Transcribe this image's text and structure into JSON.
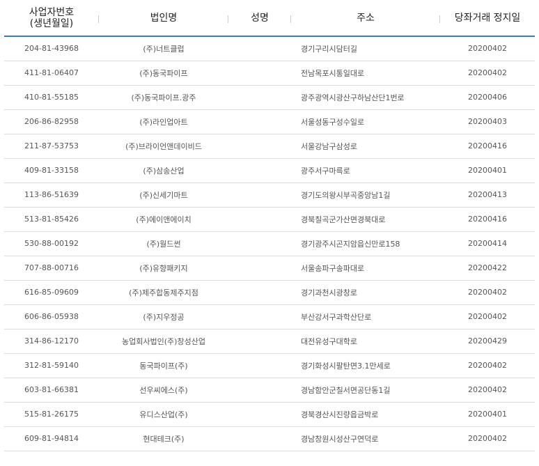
{
  "headers": {
    "biz_no_line1": "사업자번호",
    "biz_no_line2": "(생년월일)",
    "corp_name": "법인명",
    "person_name": "성명",
    "address": "주소",
    "suspend_date": "당좌거래 정지일"
  },
  "rows": [
    {
      "biz_no": "204-81-43968",
      "corp": "(주)너트클럽",
      "name": "",
      "addr": "경기구리시담터길",
      "date": "20200402"
    },
    {
      "biz_no": "411-81-06407",
      "corp": "(주)동국파이프",
      "name": "",
      "addr": "전남목포시통일대로",
      "date": "20200402"
    },
    {
      "biz_no": "410-81-55185",
      "corp": "(주)동국파이프.광주",
      "name": "",
      "addr": "광주광역시광산구하남산단1번로",
      "date": "20200406"
    },
    {
      "biz_no": "206-86-82958",
      "corp": "(주)라인업아트",
      "name": "",
      "addr": "서울성동구성수일로",
      "date": "20200403"
    },
    {
      "biz_no": "211-87-53753",
      "corp": "(주)브라이언앤데이비드",
      "name": "",
      "addr": "서울강남구삼성로",
      "date": "20200416"
    },
    {
      "biz_no": "409-81-33158",
      "corp": "(주)삼송산업",
      "name": "",
      "addr": "광주서구마륵로",
      "date": "20200401"
    },
    {
      "biz_no": "113-86-51639",
      "corp": "(주)신세기마트",
      "name": "",
      "addr": "경기도의왕시부곡중앙남1길",
      "date": "20200413"
    },
    {
      "biz_no": "513-81-85426",
      "corp": "(주)에이앤에이치",
      "name": "",
      "addr": "경북칠곡군가산면경북대로",
      "date": "20200416"
    },
    {
      "biz_no": "530-88-00192",
      "corp": "(주)월드썬",
      "name": "",
      "addr": "경기광주시곤지암읍신만로158",
      "date": "20200414"
    },
    {
      "biz_no": "707-88-00716",
      "corp": "(주)유향패키지",
      "name": "",
      "addr": "서울송파구송파대로",
      "date": "20200422"
    },
    {
      "biz_no": "616-85-09609",
      "corp": "(주)제주합동제주지점",
      "name": "",
      "addr": "경기과천시광창로",
      "date": "20200402"
    },
    {
      "biz_no": "606-86-05938",
      "corp": "(주)지우정공",
      "name": "",
      "addr": "부산강서구과학산단로",
      "date": "20200402"
    },
    {
      "biz_no": "314-86-12170",
      "corp": "농업회사법인(주)창성산업",
      "name": "",
      "addr": "대전유성구대학로",
      "date": "20200429"
    },
    {
      "biz_no": "312-81-59140",
      "corp": "동국파이프(주)",
      "name": "",
      "addr": "경기화성시팔탄면3.1만세로",
      "date": "20200402"
    },
    {
      "biz_no": "603-81-66381",
      "corp": "선우씨에스(주)",
      "name": "",
      "addr": "경남함안군칠서면공단동1길",
      "date": "20200402"
    },
    {
      "biz_no": "515-81-26175",
      "corp": "유디스산업(주)",
      "name": "",
      "addr": "경북경산시진량읍금박로",
      "date": "20200401"
    },
    {
      "biz_no": "609-81-94814",
      "corp": "현대테크(주)",
      "name": "",
      "addr": "경남창원시성산구연덕로",
      "date": "20200402"
    }
  ],
  "colors": {
    "header_rule": "#3a78c3",
    "row_divider": "#dddddd",
    "header_text": "#222222",
    "body_text": "#555555"
  }
}
